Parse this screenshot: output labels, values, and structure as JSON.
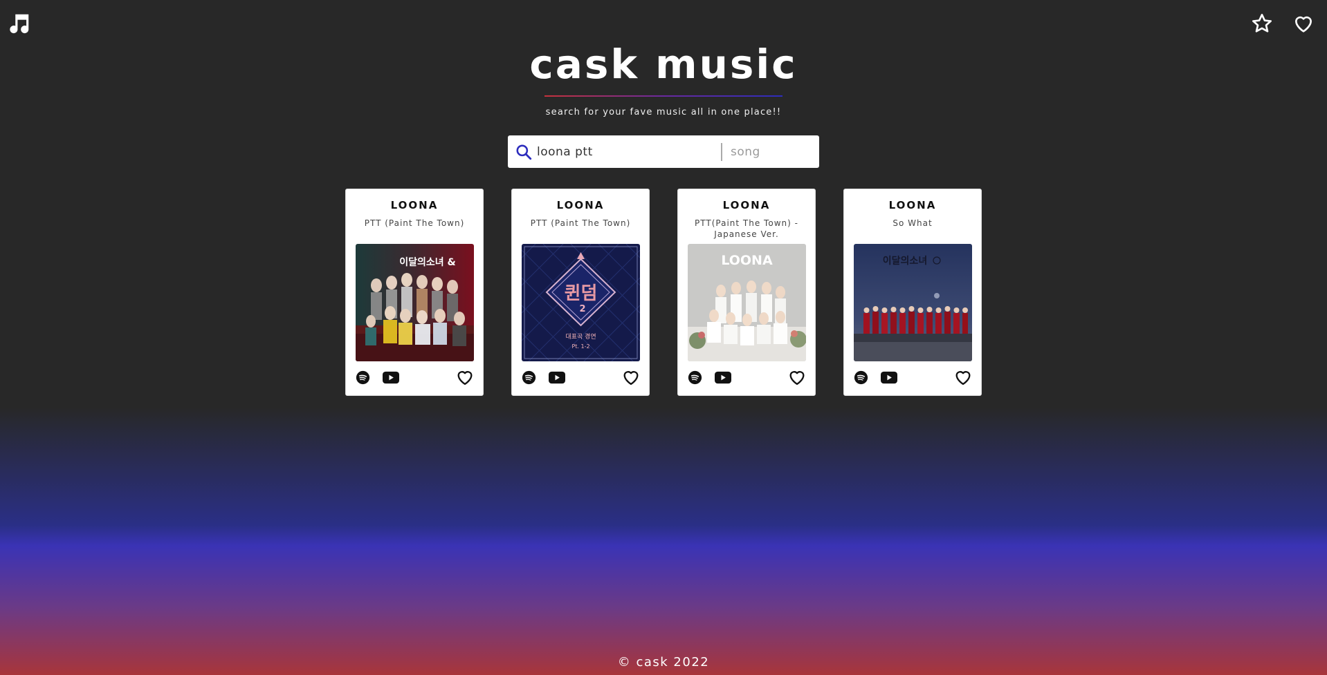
{
  "app": {
    "logo_icon": "music-note-icon"
  },
  "top_actions": [
    {
      "name": "favorites-star",
      "icon": "star-icon"
    },
    {
      "name": "liked-heart",
      "icon": "heart-icon"
    }
  ],
  "header": {
    "title": "cask music",
    "subtitle": "search for your fave music all in one place!!"
  },
  "search": {
    "icon": "search-icon",
    "query_value": "loona ptt",
    "type_placeholder": "song"
  },
  "results": [
    {
      "artist": "LOONA",
      "song": "PTT (Paint The Town)",
      "art": "album-1"
    },
    {
      "artist": "LOONA",
      "song": "PTT (Paint The Town)",
      "art": "album-2"
    },
    {
      "artist": "LOONA",
      "song": "PTT(Paint The Town) - Japanese Ver.",
      "art": "album-3"
    },
    {
      "artist": "LOONA",
      "song": "So What",
      "art": "album-4"
    }
  ],
  "album_art_text": {
    "album_1": "이달의소녀 &",
    "album_2_main": "퀸덤",
    "album_2_num": "2",
    "album_2_sub": "대표곡 경연",
    "album_2_part": "Pt. 1-2",
    "album_3": "LOONA",
    "album_4": "이달의소녀"
  },
  "footer": {
    "text": "© cask 2022"
  },
  "colors": {
    "background": "#282828",
    "card": "#ffffff",
    "accent_red": "#c8323c",
    "accent_blue": "#2d2dbd"
  }
}
